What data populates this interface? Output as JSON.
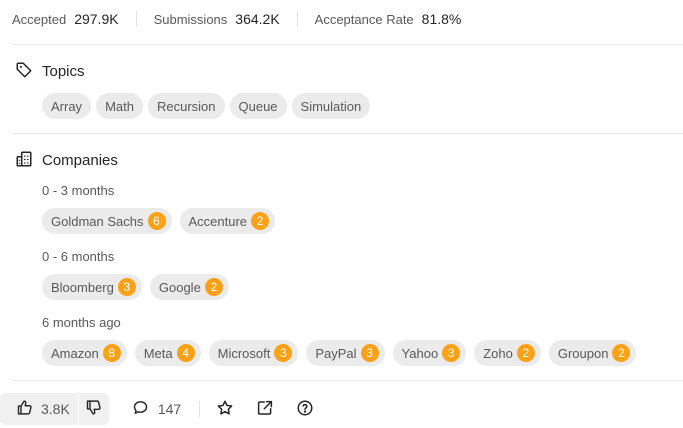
{
  "stats": [
    {
      "label": "Accepted",
      "value": "297.9K"
    },
    {
      "label": "Submissions",
      "value": "364.2K"
    },
    {
      "label": "Acceptance Rate",
      "value": "81.8%"
    }
  ],
  "topics": {
    "title": "Topics",
    "tags": [
      "Array",
      "Math",
      "Recursion",
      "Queue",
      "Simulation"
    ]
  },
  "companies": {
    "title": "Companies",
    "groups": [
      {
        "period": "0 - 3 months",
        "items": [
          {
            "name": "Goldman Sachs",
            "count": "6"
          },
          {
            "name": "Accenture",
            "count": "2"
          }
        ]
      },
      {
        "period": "0 - 6 months",
        "items": [
          {
            "name": "Bloomberg",
            "count": "3"
          },
          {
            "name": "Google",
            "count": "2"
          }
        ]
      },
      {
        "period": "6 months ago",
        "items": [
          {
            "name": "Amazon",
            "count": "8"
          },
          {
            "name": "Meta",
            "count": "4"
          },
          {
            "name": "Microsoft",
            "count": "3"
          },
          {
            "name": "PayPal",
            "count": "3"
          },
          {
            "name": "Yahoo",
            "count": "3"
          },
          {
            "name": "Zoho",
            "count": "2"
          },
          {
            "name": "Groupon",
            "count": "2"
          }
        ]
      }
    ]
  },
  "footer": {
    "likes": "3.8K",
    "comments": "147",
    "icons": [
      "thumbs-up-icon",
      "thumbs-down-icon",
      "comment-icon",
      "star-icon",
      "share-icon",
      "help-icon"
    ]
  },
  "colors": {
    "badge": "#ffa116",
    "chip_bg": "#ebebeb",
    "text": "#262626",
    "muted": "#595959"
  }
}
